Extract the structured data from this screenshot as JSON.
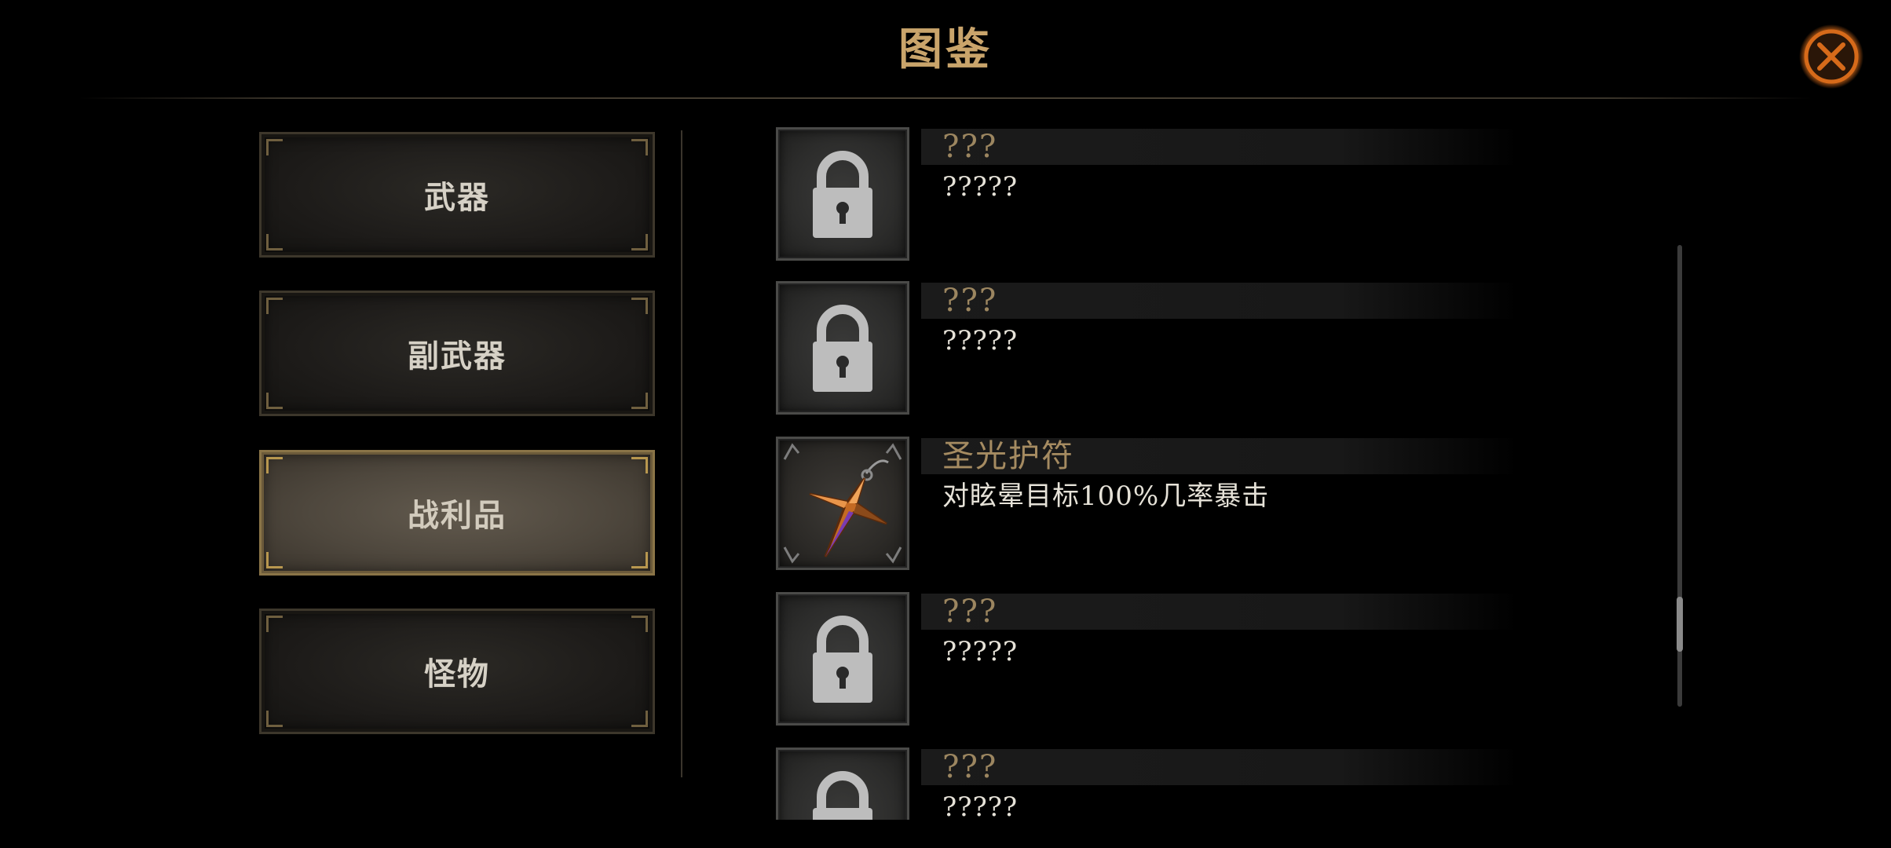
{
  "header": {
    "title": "图鉴",
    "close_icon": "close-x-icon"
  },
  "categories": [
    {
      "label": "武器",
      "active": false
    },
    {
      "label": "副武器",
      "active": false
    },
    {
      "label": "战利品",
      "active": true
    },
    {
      "label": "怪物",
      "active": false
    }
  ],
  "entries": [
    {
      "name": "???",
      "desc": "?????",
      "locked": true,
      "icon": "lock-icon"
    },
    {
      "name": "???",
      "desc": "?????",
      "locked": true,
      "icon": "lock-icon"
    },
    {
      "name": "圣光护符",
      "desc": "对眩晕目标100%几率暴击",
      "locked": false,
      "icon": "holy-amulet-icon"
    },
    {
      "name": "???",
      "desc": "?????",
      "locked": true,
      "icon": "lock-icon"
    },
    {
      "name": "???",
      "desc": "?????",
      "locked": true,
      "icon": "lock-icon"
    }
  ],
  "colors": {
    "title_gold": "#c9a46b",
    "active_tab_border": "#b8974f",
    "close_orange": "#e8731c"
  }
}
